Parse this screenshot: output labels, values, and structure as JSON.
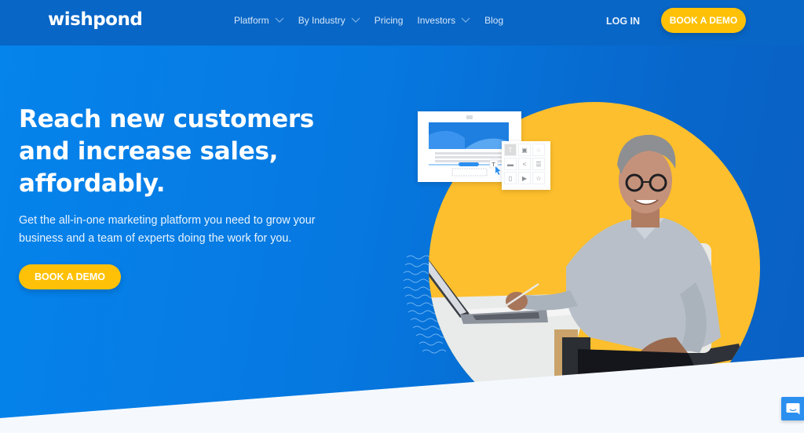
{
  "brand": {
    "name": "wishpond",
    "accent": "#fec107",
    "primary": "#0866c6"
  },
  "header": {
    "nav": [
      {
        "label": "Platform",
        "has_dropdown": true
      },
      {
        "label": "By Industry",
        "has_dropdown": true
      },
      {
        "label": "Pricing",
        "has_dropdown": false
      },
      {
        "label": "Investors",
        "has_dropdown": true
      },
      {
        "label": "Blog",
        "has_dropdown": false
      }
    ],
    "login_label": "LOG IN",
    "cta_label": "BOOK A DEMO"
  },
  "hero": {
    "headline_lines": [
      "Reach new customers",
      "and increase sales,",
      "affordably."
    ],
    "subtext_lines": [
      "Get the all-in-one marketing platform you need to grow your",
      "business and a team of experts doing the work for you."
    ],
    "cta_label": "BOOK A DEMO"
  },
  "illustration": {
    "widget_icons": [
      "text-icon",
      "image-icon",
      "chat-bubble-icon",
      "divider-icon",
      "share-icon",
      "list-icon",
      "document-icon",
      "video-icon",
      "star-icon"
    ],
    "widget_glyphs": [
      "T",
      "▣",
      "◌",
      "▬",
      "<",
      "☰",
      "▯",
      "▶",
      "☆"
    ],
    "cursor_glyph": "T"
  },
  "chat_widget": {
    "icon": "chat-icon"
  }
}
